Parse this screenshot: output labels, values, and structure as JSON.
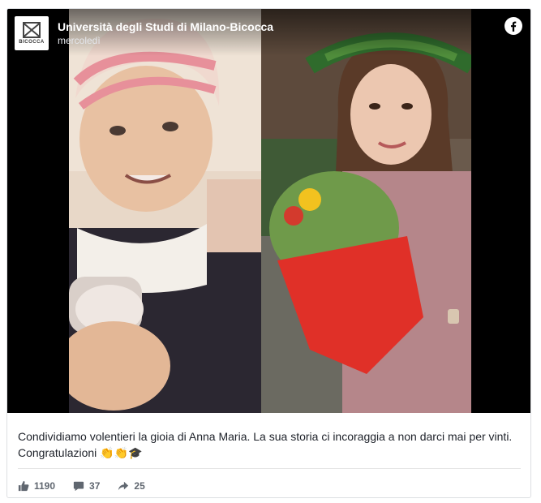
{
  "post": {
    "page_name": "Università degli Studi di Milano-Bicocca",
    "time": "mercoledì",
    "logo_text": "BICOCCA",
    "caption_line1": "Condividiamo volentieri la gioia di Anna Maria. La sua storia ci incoraggia a non darci mai per vinti.",
    "caption_line2": "Congratulazioni 👏👏🎓"
  },
  "stats": {
    "likes": "1190",
    "comments": "37",
    "shares": "25"
  },
  "icons": {
    "brand": "facebook-icon",
    "like": "thumbs-up-icon",
    "comment": "comment-icon",
    "share": "share-arrow-icon"
  },
  "colors": {
    "brand": "#ffffff",
    "text": "#1d2129",
    "muted": "#606770"
  }
}
